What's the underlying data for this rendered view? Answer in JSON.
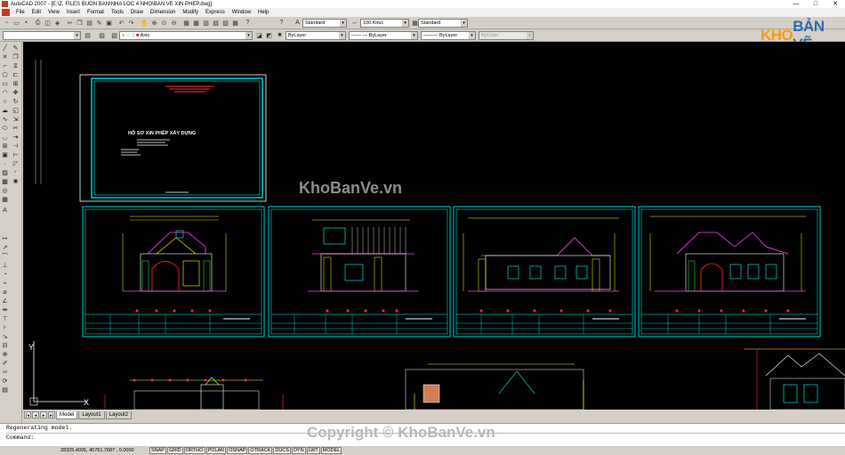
{
  "titlebar": {
    "title": "AutoCAD 2007 - [E:\\Z. FILES BUON BAN\\NHA LOC 4 NHO\\BAN VE XIN PHEP.dwg]",
    "minimize": "—",
    "restore": "□",
    "close": "✕"
  },
  "menubar": {
    "items": [
      "File",
      "Edit",
      "View",
      "Insert",
      "Format",
      "Tools",
      "Draw",
      "Dimension",
      "Modify",
      "Express",
      "Window",
      "Help"
    ]
  },
  "toolbar": {
    "text_style": "Standard",
    "dim_style": "100 Kiruc",
    "table_style": "Standard",
    "layer": "Axis",
    "color": "ByLayer",
    "linetype": "ByLayer",
    "lineweight": "ByLayer",
    "plotstyle": "ByColor"
  },
  "drawing": {
    "cover_title": "HỒ SƠ XIN PHÉP XÂY DỰNG"
  },
  "layouts": {
    "tabs": [
      "Model",
      "Layout1",
      "Layout2"
    ]
  },
  "command": {
    "history": "Regenerating model.",
    "prompt": "Command:"
  },
  "status": {
    "coords": "28325.4005, 45761.7687 , 0.0000",
    "toggles": [
      "SNAP",
      "GRID",
      "ORTHO",
      "POLAR",
      "OSNAP",
      "OTRACK",
      "DUCS",
      "DYN",
      "LWT",
      "MODEL"
    ]
  },
  "watermark": {
    "logo_kho": "KHO",
    "logo_banve": "BẢN VẼ",
    "center": "KhoBanVe.vn",
    "bottom": "Copyright © KhoBanVe.vn"
  },
  "colors": {
    "canvas": "#000000",
    "cyan": "#00ffff",
    "yellow": "#ffff00",
    "red": "#ff3030",
    "magenta": "#ff40ff",
    "green": "#33ff33",
    "white": "#ffffff"
  }
}
